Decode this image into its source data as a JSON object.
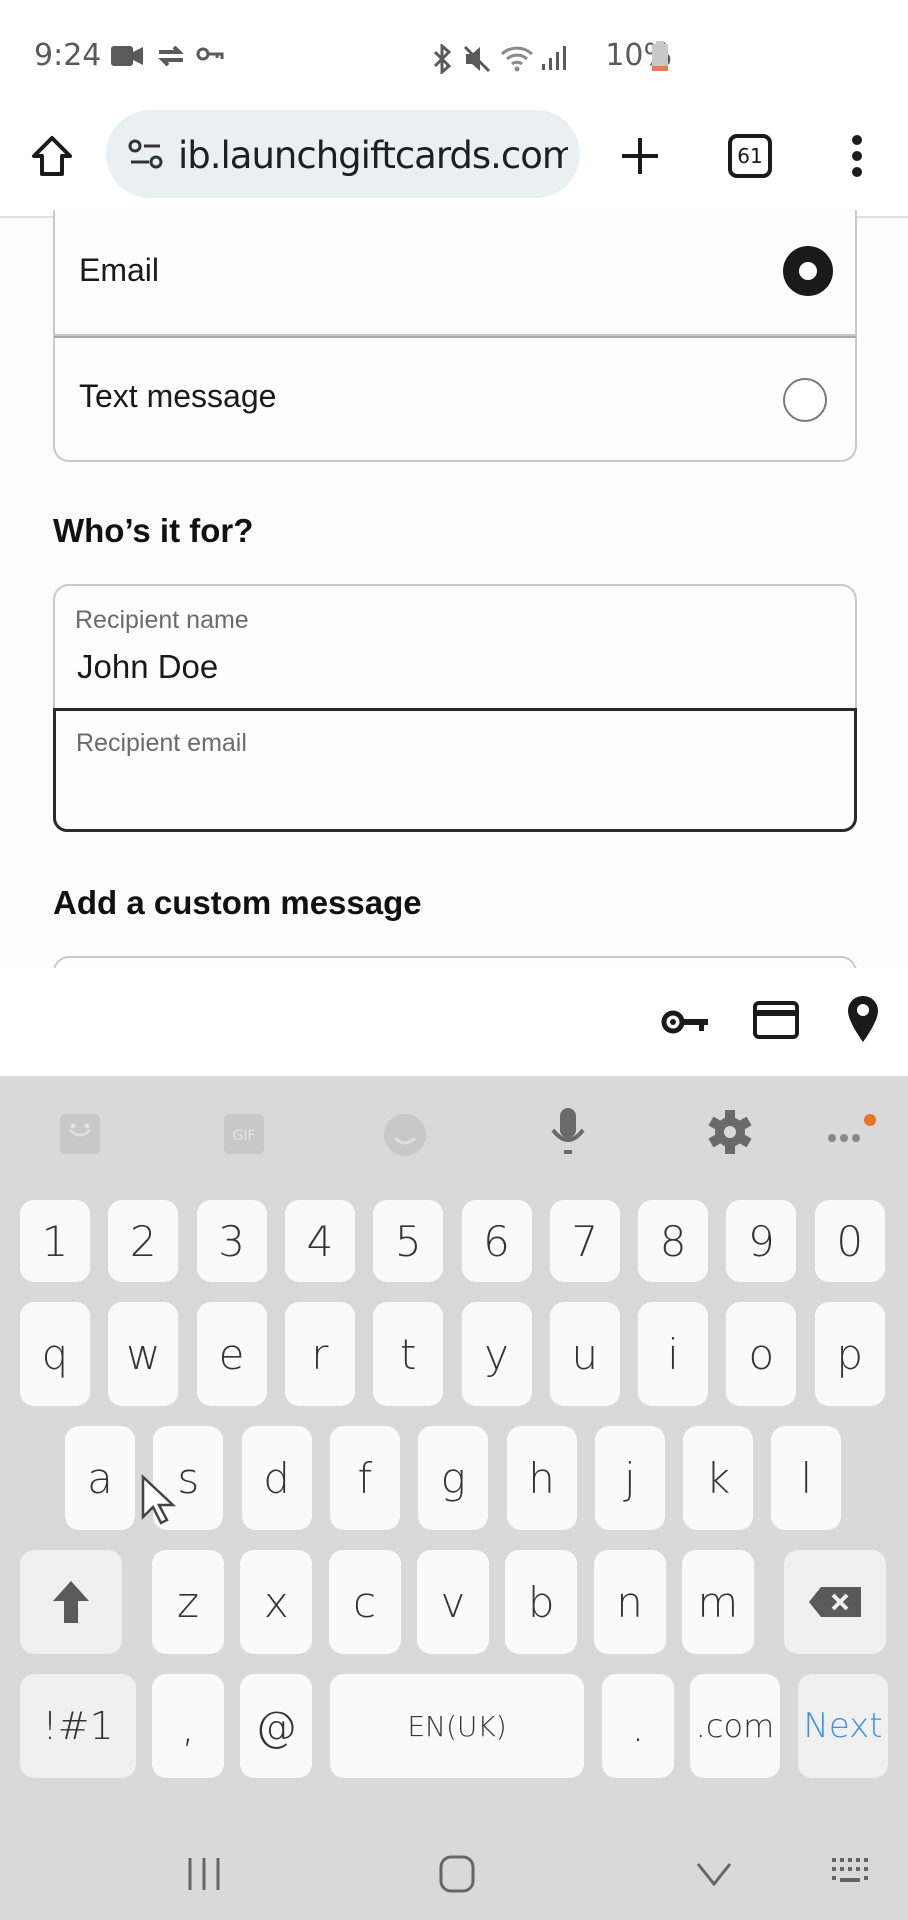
{
  "status_bar": {
    "time": "9:24",
    "battery": "10%",
    "left_icons": [
      "video-record-icon",
      "sync-icon",
      "vpn-key-icon"
    ],
    "right_icons": [
      "bluetooth-icon",
      "mute-icon",
      "wifi-icon",
      "signal-icon",
      "battery-low-icon"
    ]
  },
  "browser": {
    "url": "ib.launchgiftcards.com",
    "tab_count": "61"
  },
  "form": {
    "delivery_options": [
      {
        "label": "Email",
        "selected": true
      },
      {
        "label": "Text message",
        "selected": false
      }
    ],
    "recipient_heading": "Who’s it for?",
    "recipient_name_label": "Recipient name",
    "recipient_name_value": "John Doe",
    "recipient_email_label": "Recipient email",
    "recipient_email_value": "",
    "custom_message_heading": "Add a custom message"
  },
  "autofill_bar": {
    "icons": [
      "key-icon",
      "credit-card-icon",
      "location-pin-icon"
    ]
  },
  "keyboard": {
    "toolbar": [
      "sticker-icon",
      "gif-icon",
      "emoji-icon",
      "microphone-icon",
      "settings-icon",
      "more-icon"
    ],
    "row_numbers": [
      "1",
      "2",
      "3",
      "4",
      "5",
      "6",
      "7",
      "8",
      "9",
      "0"
    ],
    "row_top": [
      "q",
      "w",
      "e",
      "r",
      "t",
      "y",
      "u",
      "i",
      "o",
      "p"
    ],
    "row_middle": [
      "a",
      "s",
      "d",
      "f",
      "g",
      "h",
      "j",
      "k",
      "l"
    ],
    "row_bottom": [
      "z",
      "x",
      "c",
      "v",
      "b",
      "n",
      "m"
    ],
    "symbols_key": "!#1",
    "comma_key": ",",
    "at_key": "@",
    "space_key": "EN(UK)",
    "period_key": ".",
    "dotcom_key": ".com",
    "action_key": "Next",
    "action_color": "#3d8fe0"
  },
  "nav_bar": [
    "recents-icon",
    "home-icon",
    "hide-keyboard-icon",
    "keyboard-switch-icon"
  ]
}
